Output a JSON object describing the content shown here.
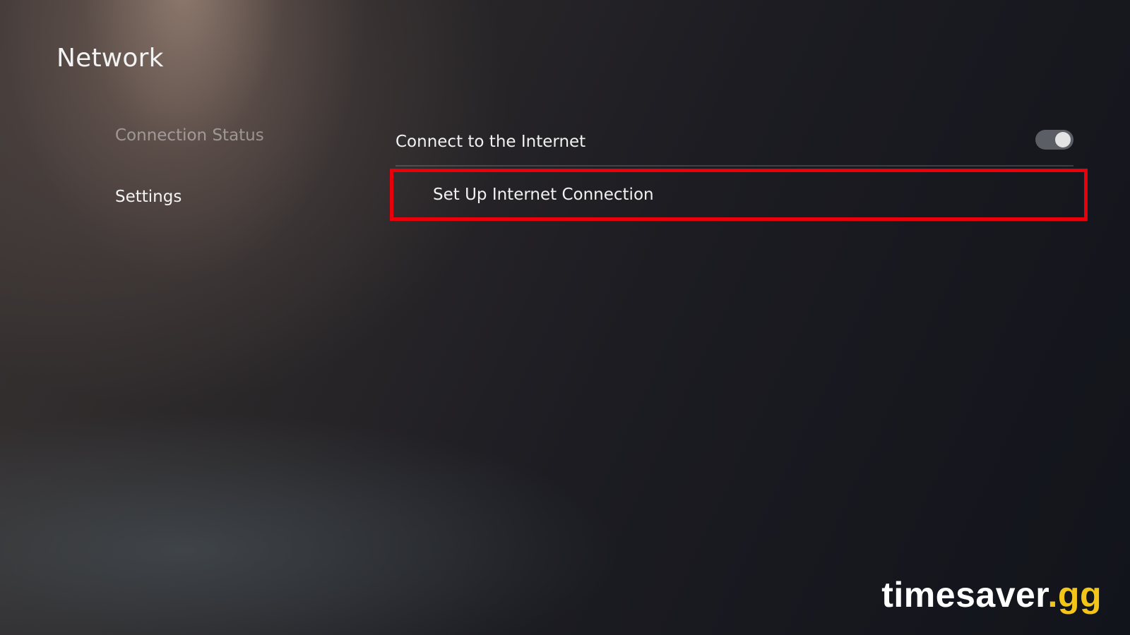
{
  "page": {
    "title": "Network"
  },
  "sidebar": {
    "items": [
      {
        "label": "Connection Status",
        "state": "dim"
      },
      {
        "label": "Settings",
        "state": "active"
      }
    ]
  },
  "settings": {
    "connect_internet": {
      "label": "Connect to the Internet",
      "toggle_on": true
    },
    "setup_connection": {
      "label": "Set Up Internet Connection",
      "highlighted": true
    }
  },
  "watermark": {
    "main": "timesaver",
    "tld": ".gg"
  },
  "colors": {
    "highlight_border": "#e8000b",
    "watermark_accent": "#f2c518",
    "toggle_track": "#5c5e66",
    "toggle_knob": "#e3e3e3"
  }
}
